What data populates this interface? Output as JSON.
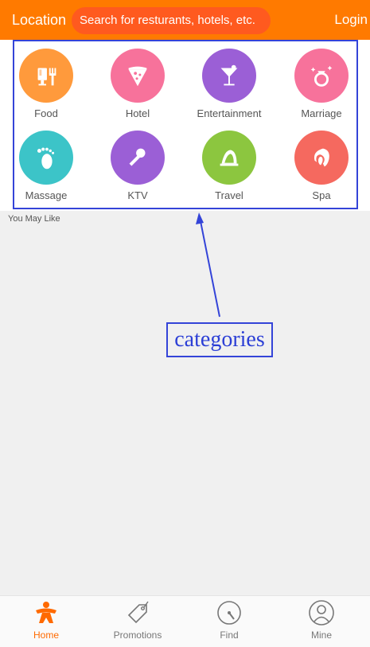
{
  "header": {
    "location": "Location",
    "search_placeholder": "Search for resturants, hotels, etc.",
    "login": "Login"
  },
  "categories": [
    {
      "label": "Food",
      "icon": "food-icon",
      "color": "#ff9a3c"
    },
    {
      "label": "Hotel",
      "icon": "hotel-icon",
      "color": "#f7729b"
    },
    {
      "label": "Entertainment",
      "icon": "cocktail-icon",
      "color": "#9b5fd6"
    },
    {
      "label": "Marriage",
      "icon": "ring-icon",
      "color": "#f7729b"
    },
    {
      "label": "Massage",
      "icon": "foot-icon",
      "color": "#3cc4c8"
    },
    {
      "label": "KTV",
      "icon": "microphone-icon",
      "color": "#9b5fd6"
    },
    {
      "label": "Travel",
      "icon": "travel-icon",
      "color": "#8cc63f"
    },
    {
      "label": "Spa",
      "icon": "spa-icon",
      "color": "#f5695f"
    }
  ],
  "section": {
    "you_may_like": "You May Like"
  },
  "annotation": {
    "label": "categories",
    "color": "#3444d8"
  },
  "tabs": [
    {
      "label": "Home",
      "icon": "home-person-icon",
      "active": true
    },
    {
      "label": "Promotions",
      "icon": "tag-icon",
      "active": false
    },
    {
      "label": "Find",
      "icon": "compass-icon",
      "active": false
    },
    {
      "label": "Mine",
      "icon": "user-icon",
      "active": false
    }
  ],
  "colors": {
    "brand": "#ff7a00",
    "search_bg": "#ff5a1f",
    "active_tab": "#ff6a00"
  }
}
